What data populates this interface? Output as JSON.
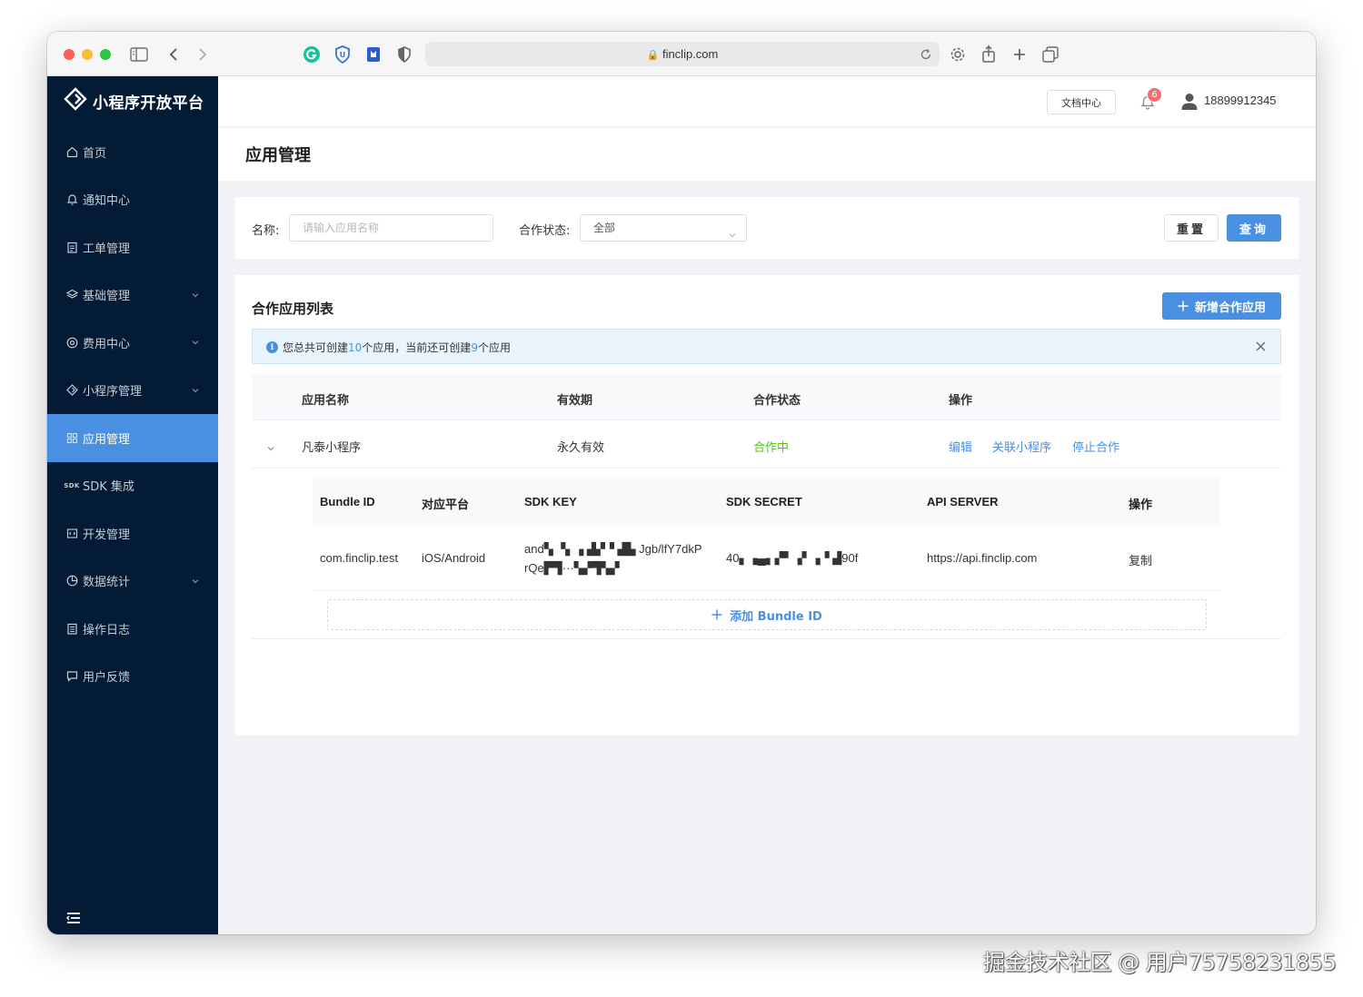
{
  "browser": {
    "url": "finclip.com"
  },
  "sidebar": {
    "logo_text": "小程序开放平台",
    "items": [
      {
        "label": "首页",
        "icon": "home-icon",
        "has_chevron": false
      },
      {
        "label": "通知中心",
        "icon": "bell-icon",
        "has_chevron": false
      },
      {
        "label": "工单管理",
        "icon": "clipboard-icon",
        "has_chevron": false
      },
      {
        "label": "基础管理",
        "icon": "layers-icon",
        "has_chevron": true
      },
      {
        "label": "费用中心",
        "icon": "coin-icon",
        "has_chevron": true
      },
      {
        "label": "小程序管理",
        "icon": "diamond-icon",
        "has_chevron": true
      },
      {
        "label": "应用管理",
        "icon": "grid-icon",
        "has_chevron": false,
        "active": true
      },
      {
        "label": "SDK 集成",
        "icon": "sdk-icon",
        "has_chevron": false
      },
      {
        "label": "开发管理",
        "icon": "code-window-icon",
        "has_chevron": false
      },
      {
        "label": "数据统计",
        "icon": "pie-chart-icon",
        "has_chevron": true
      },
      {
        "label": "操作日志",
        "icon": "log-icon",
        "has_chevron": false
      },
      {
        "label": "用户反馈",
        "icon": "message-icon",
        "has_chevron": false
      }
    ],
    "sdk_mini": "SDK"
  },
  "header": {
    "doc_button": "文档中心",
    "notification_count": "6",
    "user_phone": "18899912345"
  },
  "page": {
    "title": "应用管理"
  },
  "filter": {
    "name_label": "名称:",
    "name_placeholder": "请输入应用名称",
    "status_label": "合作状态:",
    "status_value": "全部",
    "reset_button": "重置",
    "query_button": "查询"
  },
  "list": {
    "title": "合作应用列表",
    "add_button": "新增合作应用",
    "alert": {
      "prefix": "您总共可创建",
      "total": "10",
      "middle": "个应用，当前还可创建",
      "remaining": "9",
      "suffix": "个应用"
    },
    "columns": [
      "应用名称",
      "有效期",
      "合作状态",
      "操作"
    ],
    "rows": [
      {
        "name": "凡泰小程序",
        "validity": "永久有效",
        "status": "合作中",
        "actions": [
          "编辑",
          "关联小程序",
          "停止合作"
        ]
      }
    ],
    "nested": {
      "columns": [
        "Bundle ID",
        "对应平台",
        "SDK KEY",
        "SDK SECRET",
        "API SERVER",
        "操作"
      ],
      "rows": [
        {
          "bundle_id": "com.finclip.test",
          "platform": "iOS/Android",
          "sdk_key_line1": "and▚ ▝▖▗ ▟▞▝ ▟▙ Jgb/lfY7dkP",
          "sdk_key_line2": "rQe▛▜···▚▞▜▚▞",
          "sdk_secret": "40▖▗▄▖▞▘▗▘▗▝ ▟90f",
          "api_server": "https://api.finclip.com",
          "action": "复制"
        }
      ],
      "add_bundle": "添加 Bundle ID"
    }
  },
  "watermark": "掘金技术社区 @ 用户75758231855",
  "colors": {
    "sidebar_bg": "#031b35",
    "accent": "#4a90e2",
    "status_green": "#52c41a",
    "badge_red": "#f56c6c"
  }
}
